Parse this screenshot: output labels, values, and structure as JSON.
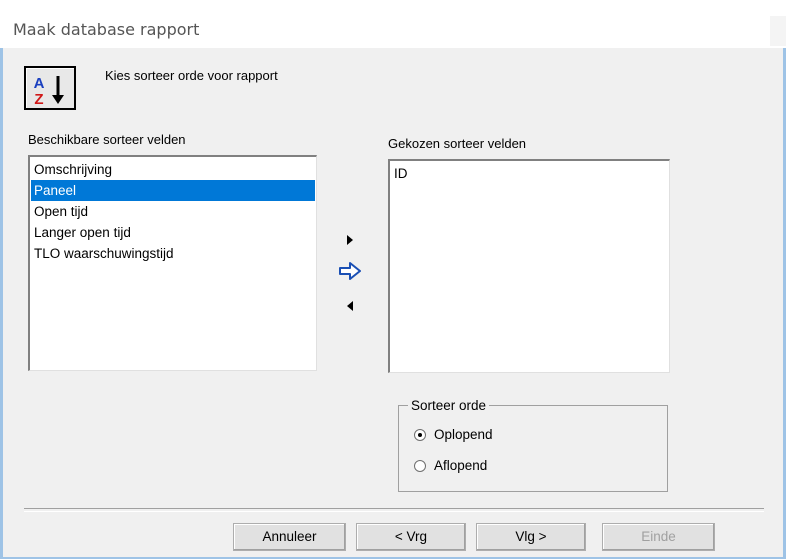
{
  "window": {
    "title": "Maak database rapport"
  },
  "header": {
    "instruction": "Kies sorteer orde voor rapport",
    "icon": "sort-az-icon"
  },
  "available": {
    "label": "Beschikbare sorteer velden",
    "items": [
      "Omschrijving",
      "Paneel",
      "Open tijd",
      "Langer open tijd",
      "TLO waarschuwingstijd"
    ],
    "selected": "Paneel"
  },
  "chosen": {
    "label": "Gekozen sorteer velden",
    "items": [
      "ID"
    ]
  },
  "sort_order": {
    "legend": "Sorteer orde",
    "options": [
      "Oplopend",
      "Aflopend"
    ],
    "selected": "Oplopend"
  },
  "buttons": {
    "cancel": "Annuleer",
    "previous": "< Vrg",
    "next": "Vlg >",
    "finish": "Einde"
  },
  "colors": {
    "selection": "#0078d7",
    "arrow": "#1a4fb4"
  }
}
